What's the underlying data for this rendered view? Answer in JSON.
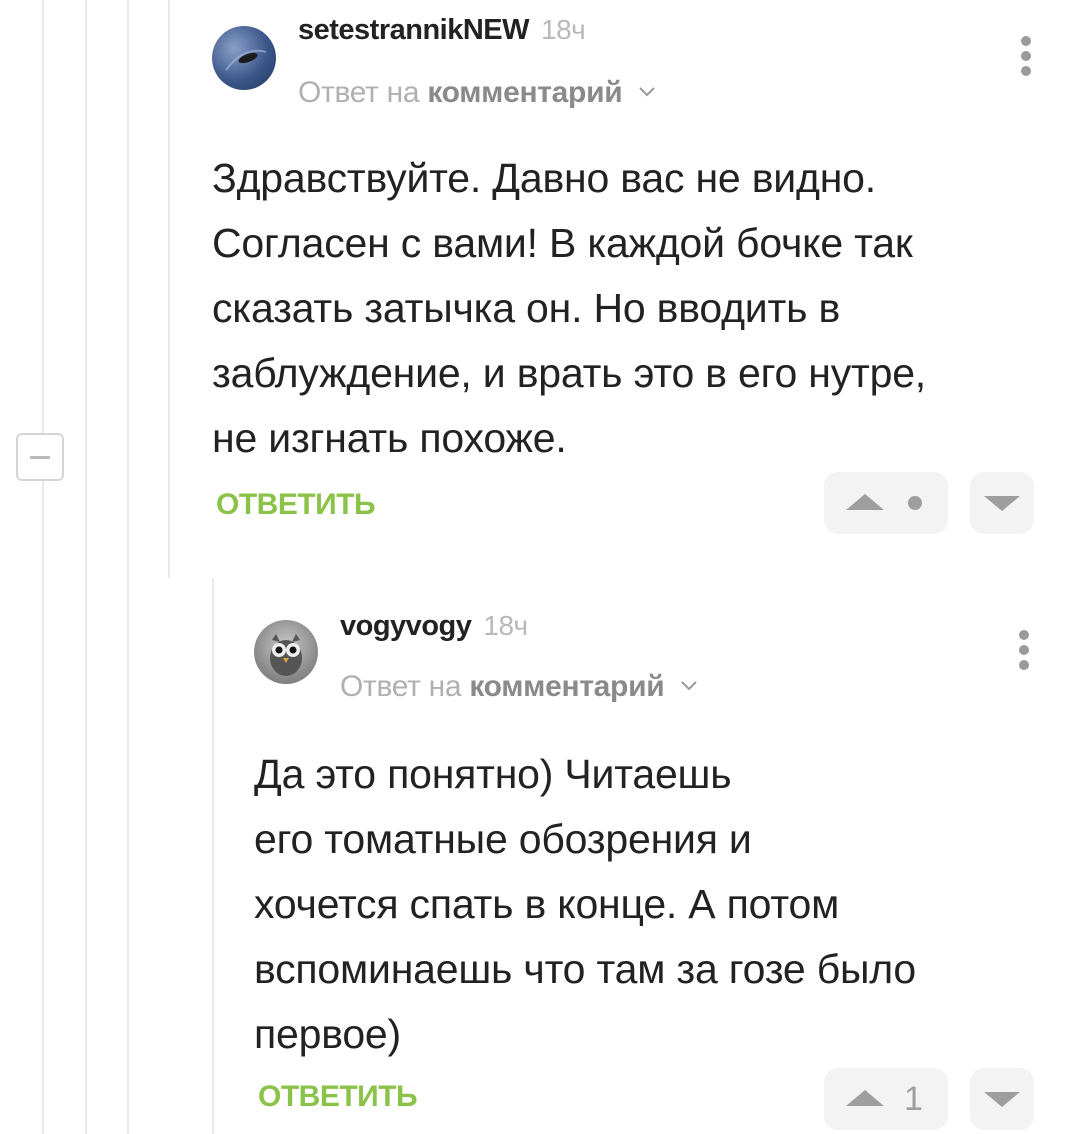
{
  "comments": [
    {
      "author": "setestrannikNEW",
      "time": "18ч",
      "reply_prefix": "Ответ на",
      "reply_link": "комментарий",
      "text": "Здравствуйте. Давно вас не видно.\nСогласен с вами! В каждой бочке так\nсказать затычка он. Но вводить в\nзаблуждение, и врать это в его нутре,\nне изгнать похоже.",
      "reply_label": "ОТВЕТИТЬ",
      "rating": "",
      "rating_shown_as": "dot"
    },
    {
      "author": "vogyvogy",
      "time": "18ч",
      "reply_prefix": "Ответ на",
      "reply_link": "комментарий",
      "text": "Да это понятно) Читаешь\nего томатные обозрения и\nхочется спать в конце. А потом\nвспоминаешь что там за гозе было\nпервое)",
      "reply_label": "ОТВЕТИТЬ",
      "rating": "1"
    }
  ],
  "icons": {
    "more": "more-vertical-icon",
    "chevron": "chevron-down-icon",
    "vote_up": "arrow-up-icon",
    "vote_down": "arrow-down-icon",
    "collapse": "minus-icon"
  },
  "colors": {
    "accent_green": "#8bc34a",
    "muted_gray": "#9e9e9e",
    "thread_line": "#e9e9e9"
  }
}
